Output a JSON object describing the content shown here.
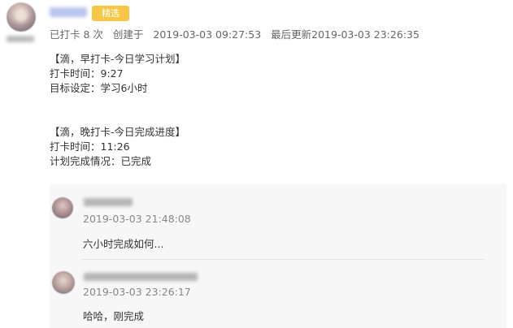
{
  "post": {
    "badge": "精选",
    "meta": {
      "checkin_count": "已打卡 8 次",
      "created_label": "创建于",
      "created_time": "2019-03-03 09:27:53",
      "updated_label": "最后更新",
      "updated_time": "2019-03-03 23:26:35"
    },
    "body_lines": [
      "【滴，早打卡-今日学习计划】",
      "打卡时间：9:27",
      "目标设定：学习6小时",
      "【滴，晚打卡-今日完成进度】",
      "打卡时间：11:26",
      "计划完成情况：已完成"
    ]
  },
  "comments": [
    {
      "time": "2019-03-03 21:48:08",
      "text": "六小时完成如何..."
    },
    {
      "time": "2019-03-03 23:26:17",
      "text": "哈哈，刚完成"
    }
  ],
  "colors": {
    "badge": "#f6c644",
    "comment_background": "#f7f7f7",
    "meta_text": "#666666"
  }
}
